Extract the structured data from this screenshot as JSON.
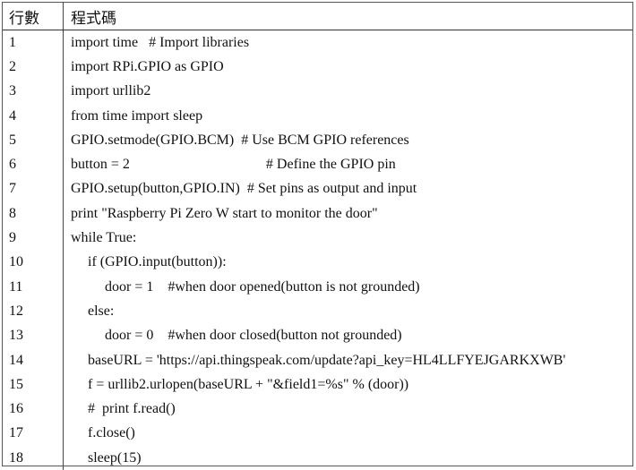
{
  "table": {
    "headers": {
      "line_no": "行數",
      "code": "程式碼"
    },
    "rows": [
      {
        "n": "1",
        "indent": 0,
        "code": "import time   # Import libraries"
      },
      {
        "n": "2",
        "indent": 0,
        "code": "import RPi.GPIO as GPIO"
      },
      {
        "n": "3",
        "indent": 0,
        "code": "import urllib2"
      },
      {
        "n": "4",
        "indent": 0,
        "code": "from time import sleep"
      },
      {
        "n": "5",
        "indent": 0,
        "code": "GPIO.setmode(GPIO.BCM)  # Use BCM GPIO references"
      },
      {
        "n": "6",
        "indent": 0,
        "code": "button = 2                                      # Define the GPIO pin"
      },
      {
        "n": "7",
        "indent": 0,
        "code": "GPIO.setup(button,GPIO.IN)  # Set pins as output and input"
      },
      {
        "n": "8",
        "indent": 0,
        "code": "print \"Raspberry Pi Zero W start to monitor the door\""
      },
      {
        "n": "9",
        "indent": 0,
        "code": "while True:"
      },
      {
        "n": "10",
        "indent": 1,
        "code": "if (GPIO.input(button)):"
      },
      {
        "n": "11",
        "indent": 2,
        "code": "door = 1    #when door opened(button is not grounded)"
      },
      {
        "n": "12",
        "indent": 1,
        "code": "else:"
      },
      {
        "n": "13",
        "indent": 2,
        "code": "door = 0    #when door closed(button not grounded)"
      },
      {
        "n": "14",
        "indent": 1,
        "code": "baseURL = 'https://api.thingspeak.com/update?api_key=HL4LLFYEJGARKXWB'"
      },
      {
        "n": "15",
        "indent": 1,
        "code": "f = urllib2.urlopen(baseURL + \"&field1=%s\" % (door))"
      },
      {
        "n": "16",
        "indent": 1,
        "code": "#  print f.read()"
      },
      {
        "n": "17",
        "indent": 1,
        "code": "f.close()"
      },
      {
        "n": "18",
        "indent": 1,
        "code": "sleep(15)"
      }
    ]
  }
}
